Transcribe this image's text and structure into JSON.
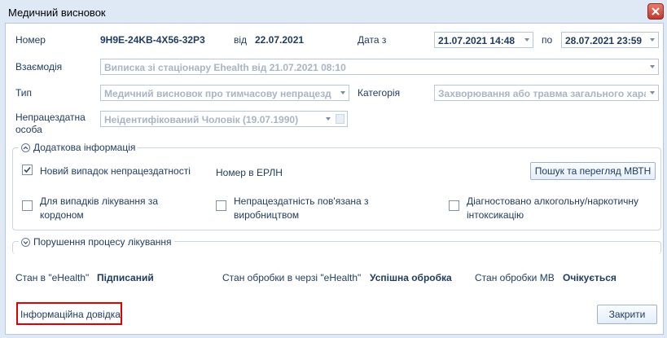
{
  "window": {
    "title": "Медичний висновок"
  },
  "header": {
    "number_label": "Номер",
    "number_value": "9H9E-24KB-4X56-32P3",
    "from_label": "від",
    "from_value": "22.07.2021",
    "date_from_label": "Дата з",
    "date_from_value": "21.07.2021 14:48",
    "date_to_label": "по",
    "date_to_value": "28.07.2021 23:59"
  },
  "fields": {
    "interaction_label": "Взаємодія",
    "interaction_value": "Виписка зі стаціонару Ehealth від 21.07.2021 08:10",
    "type_label": "Тип",
    "type_value": "Медичний висновок про тимчасову непрацезд",
    "category_label": "Категорія",
    "category_value": "Захворювання або травма загального хара",
    "person_label_1": "Непрацездатна",
    "person_label_2": "особа",
    "person_value": "Неідентифікований Чоловік (19.07.1990)"
  },
  "additional": {
    "header": "Додаткова інформація",
    "new_case_label": "Новий випадок непрацездатності",
    "new_case_checked": true,
    "erln_label": "Номер в ЕРЛН",
    "search_button": "Пошук та перегляд МВТН",
    "abroad_label_1": "Для випадків лікування за",
    "abroad_label_2": "кордоном",
    "production_label_1": "Непрацездатність пов'язана з",
    "production_label_2": "виробництвом",
    "alcohol_label_1": "Діагностовано алкогольну/наркотичну",
    "alcohol_label_2": "інтоксикацію"
  },
  "violation": {
    "header": "Порушення процесу лікування"
  },
  "status": {
    "ehealth_label": "Стан в \"eHealth\"",
    "ehealth_value": "Підписаний",
    "queue_label": "Стан обробки в черзі \"eHealth\"",
    "queue_value": "Успішна обробка",
    "mv_label": "Стан обробки МВ",
    "mv_value": "Очікується"
  },
  "footer": {
    "info_link": "Інформаційна довідка",
    "close_button": "Закрити"
  },
  "colors": {
    "highlight": "#e00000",
    "text": "#1e3a5f",
    "disabled_text": "#a9b5c4"
  }
}
